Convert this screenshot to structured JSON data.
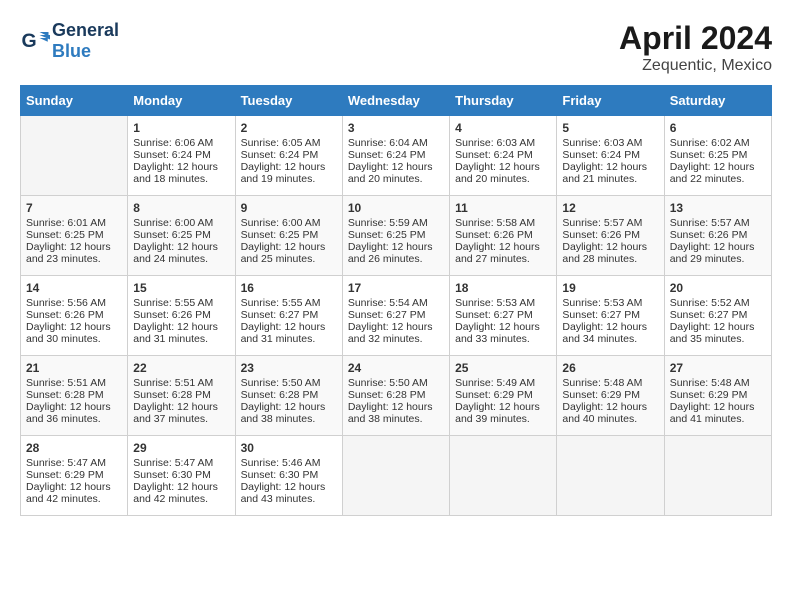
{
  "header": {
    "logo_general": "General",
    "logo_blue": "Blue",
    "title": "April 2024",
    "subtitle": "Zequentic, Mexico"
  },
  "columns": [
    "Sunday",
    "Monday",
    "Tuesday",
    "Wednesday",
    "Thursday",
    "Friday",
    "Saturday"
  ],
  "weeks": [
    [
      {
        "day": "",
        "sunrise": "",
        "sunset": "",
        "daylight": "",
        "empty": true
      },
      {
        "day": "1",
        "sunrise": "Sunrise: 6:06 AM",
        "sunset": "Sunset: 6:24 PM",
        "daylight": "Daylight: 12 hours and 18 minutes."
      },
      {
        "day": "2",
        "sunrise": "Sunrise: 6:05 AM",
        "sunset": "Sunset: 6:24 PM",
        "daylight": "Daylight: 12 hours and 19 minutes."
      },
      {
        "day": "3",
        "sunrise": "Sunrise: 6:04 AM",
        "sunset": "Sunset: 6:24 PM",
        "daylight": "Daylight: 12 hours and 20 minutes."
      },
      {
        "day": "4",
        "sunrise": "Sunrise: 6:03 AM",
        "sunset": "Sunset: 6:24 PM",
        "daylight": "Daylight: 12 hours and 20 minutes."
      },
      {
        "day": "5",
        "sunrise": "Sunrise: 6:03 AM",
        "sunset": "Sunset: 6:24 PM",
        "daylight": "Daylight: 12 hours and 21 minutes."
      },
      {
        "day": "6",
        "sunrise": "Sunrise: 6:02 AM",
        "sunset": "Sunset: 6:25 PM",
        "daylight": "Daylight: 12 hours and 22 minutes."
      }
    ],
    [
      {
        "day": "7",
        "sunrise": "Sunrise: 6:01 AM",
        "sunset": "Sunset: 6:25 PM",
        "daylight": "Daylight: 12 hours and 23 minutes."
      },
      {
        "day": "8",
        "sunrise": "Sunrise: 6:00 AM",
        "sunset": "Sunset: 6:25 PM",
        "daylight": "Daylight: 12 hours and 24 minutes."
      },
      {
        "day": "9",
        "sunrise": "Sunrise: 6:00 AM",
        "sunset": "Sunset: 6:25 PM",
        "daylight": "Daylight: 12 hours and 25 minutes."
      },
      {
        "day": "10",
        "sunrise": "Sunrise: 5:59 AM",
        "sunset": "Sunset: 6:25 PM",
        "daylight": "Daylight: 12 hours and 26 minutes."
      },
      {
        "day": "11",
        "sunrise": "Sunrise: 5:58 AM",
        "sunset": "Sunset: 6:26 PM",
        "daylight": "Daylight: 12 hours and 27 minutes."
      },
      {
        "day": "12",
        "sunrise": "Sunrise: 5:57 AM",
        "sunset": "Sunset: 6:26 PM",
        "daylight": "Daylight: 12 hours and 28 minutes."
      },
      {
        "day": "13",
        "sunrise": "Sunrise: 5:57 AM",
        "sunset": "Sunset: 6:26 PM",
        "daylight": "Daylight: 12 hours and 29 minutes."
      }
    ],
    [
      {
        "day": "14",
        "sunrise": "Sunrise: 5:56 AM",
        "sunset": "Sunset: 6:26 PM",
        "daylight": "Daylight: 12 hours and 30 minutes."
      },
      {
        "day": "15",
        "sunrise": "Sunrise: 5:55 AM",
        "sunset": "Sunset: 6:26 PM",
        "daylight": "Daylight: 12 hours and 31 minutes."
      },
      {
        "day": "16",
        "sunrise": "Sunrise: 5:55 AM",
        "sunset": "Sunset: 6:27 PM",
        "daylight": "Daylight: 12 hours and 31 minutes."
      },
      {
        "day": "17",
        "sunrise": "Sunrise: 5:54 AM",
        "sunset": "Sunset: 6:27 PM",
        "daylight": "Daylight: 12 hours and 32 minutes."
      },
      {
        "day": "18",
        "sunrise": "Sunrise: 5:53 AM",
        "sunset": "Sunset: 6:27 PM",
        "daylight": "Daylight: 12 hours and 33 minutes."
      },
      {
        "day": "19",
        "sunrise": "Sunrise: 5:53 AM",
        "sunset": "Sunset: 6:27 PM",
        "daylight": "Daylight: 12 hours and 34 minutes."
      },
      {
        "day": "20",
        "sunrise": "Sunrise: 5:52 AM",
        "sunset": "Sunset: 6:27 PM",
        "daylight": "Daylight: 12 hours and 35 minutes."
      }
    ],
    [
      {
        "day": "21",
        "sunrise": "Sunrise: 5:51 AM",
        "sunset": "Sunset: 6:28 PM",
        "daylight": "Daylight: 12 hours and 36 minutes."
      },
      {
        "day": "22",
        "sunrise": "Sunrise: 5:51 AM",
        "sunset": "Sunset: 6:28 PM",
        "daylight": "Daylight: 12 hours and 37 minutes."
      },
      {
        "day": "23",
        "sunrise": "Sunrise: 5:50 AM",
        "sunset": "Sunset: 6:28 PM",
        "daylight": "Daylight: 12 hours and 38 minutes."
      },
      {
        "day": "24",
        "sunrise": "Sunrise: 5:50 AM",
        "sunset": "Sunset: 6:28 PM",
        "daylight": "Daylight: 12 hours and 38 minutes."
      },
      {
        "day": "25",
        "sunrise": "Sunrise: 5:49 AM",
        "sunset": "Sunset: 6:29 PM",
        "daylight": "Daylight: 12 hours and 39 minutes."
      },
      {
        "day": "26",
        "sunrise": "Sunrise: 5:48 AM",
        "sunset": "Sunset: 6:29 PM",
        "daylight": "Daylight: 12 hours and 40 minutes."
      },
      {
        "day": "27",
        "sunrise": "Sunrise: 5:48 AM",
        "sunset": "Sunset: 6:29 PM",
        "daylight": "Daylight: 12 hours and 41 minutes."
      }
    ],
    [
      {
        "day": "28",
        "sunrise": "Sunrise: 5:47 AM",
        "sunset": "Sunset: 6:29 PM",
        "daylight": "Daylight: 12 hours and 42 minutes."
      },
      {
        "day": "29",
        "sunrise": "Sunrise: 5:47 AM",
        "sunset": "Sunset: 6:30 PM",
        "daylight": "Daylight: 12 hours and 42 minutes."
      },
      {
        "day": "30",
        "sunrise": "Sunrise: 5:46 AM",
        "sunset": "Sunset: 6:30 PM",
        "daylight": "Daylight: 12 hours and 43 minutes."
      },
      {
        "day": "",
        "sunrise": "",
        "sunset": "",
        "daylight": "",
        "empty": true
      },
      {
        "day": "",
        "sunrise": "",
        "sunset": "",
        "daylight": "",
        "empty": true
      },
      {
        "day": "",
        "sunrise": "",
        "sunset": "",
        "daylight": "",
        "empty": true
      },
      {
        "day": "",
        "sunrise": "",
        "sunset": "",
        "daylight": "",
        "empty": true
      }
    ]
  ]
}
